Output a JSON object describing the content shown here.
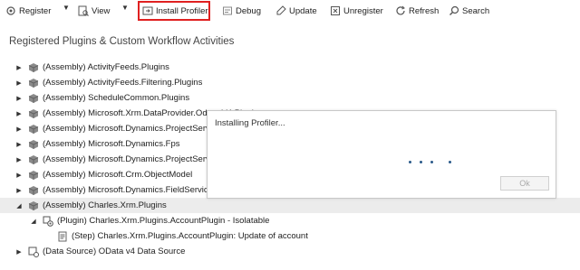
{
  "toolbar": {
    "register": "Register",
    "view": "View",
    "install_profiler": "Install Profiler",
    "debug": "Debug",
    "update": "Update",
    "unregister": "Unregister",
    "refresh": "Refresh",
    "search": "Search"
  },
  "section_title": "Registered Plugins & Custom Workflow Activities",
  "tree": [
    {
      "label": "(Assembly) ActivityFeeds.Plugins"
    },
    {
      "label": "(Assembly) ActivityFeeds.Filtering.Plugins"
    },
    {
      "label": "(Assembly) ScheduleCommon.Plugins"
    },
    {
      "label": "(Assembly) Microsoft.Xrm.DataProvider.Odata.V4.Plugins"
    },
    {
      "label": "(Assembly) Microsoft.Dynamics.ProjectService.Plugins"
    },
    {
      "label": "(Assembly) Microsoft.Dynamics.Fps"
    },
    {
      "label": "(Assembly) Microsoft.Dynamics.ProjectService.Plugins"
    },
    {
      "label": "(Assembly) Microsoft.Crm.ObjectModel"
    },
    {
      "label": "(Assembly) Microsoft.Dynamics.FieldService"
    },
    {
      "label": "(Assembly) Charles.Xrm.Plugins"
    },
    {
      "label": "(Plugin) Charles.Xrm.Plugins.AccountPlugin - Isolatable"
    },
    {
      "label": "(Step) Charles.Xrm.Plugins.AccountPlugin: Update of account"
    },
    {
      "label": "(Data Source) OData v4 Data Source"
    }
  ],
  "dialog": {
    "title": "Installing Profiler...",
    "ok_label": "Ok"
  },
  "colors": {
    "highlight": "#e02020",
    "selected_row": "#ececec"
  }
}
